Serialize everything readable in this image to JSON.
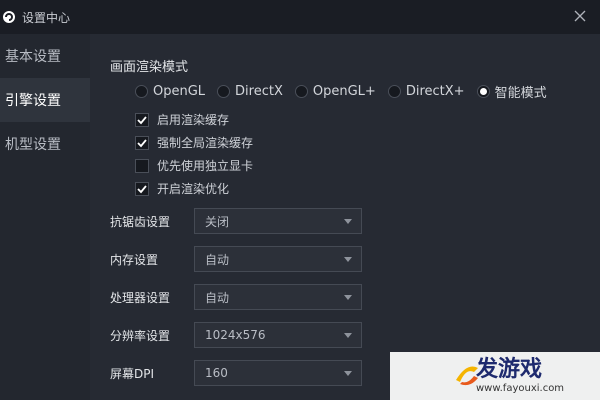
{
  "window": {
    "title": "设置中心"
  },
  "sidebar": {
    "items": [
      {
        "label": "基本设置"
      },
      {
        "label": "引擎设置"
      },
      {
        "label": "机型设置"
      }
    ]
  },
  "render": {
    "title": "画面渲染模式",
    "options": [
      "OpenGL",
      "DirectX",
      "OpenGL+",
      "DirectX+",
      "智能模式"
    ],
    "selected": "智能模式",
    "checks": [
      {
        "label": "启用渲染缓存",
        "checked": true
      },
      {
        "label": "强制全局渲染缓存",
        "checked": true
      },
      {
        "label": "优先使用独立显卡",
        "checked": false
      },
      {
        "label": "开启渲染优化",
        "checked": true
      }
    ]
  },
  "settings": [
    {
      "label": "抗锯齿设置",
      "value": "关闭"
    },
    {
      "label": "内存设置",
      "value": "自动"
    },
    {
      "label": "处理器设置",
      "value": "自动"
    },
    {
      "label": "分辨率设置",
      "value": "1024x576"
    },
    {
      "label": "屏幕DPI",
      "value": "160"
    }
  ],
  "watermark": {
    "brand": "发游戏",
    "url": "www.fayouxi.com"
  },
  "colors": {
    "background": "#1f232c",
    "sidebar_active": "#2f343d",
    "checkmark": "#ffffff"
  }
}
